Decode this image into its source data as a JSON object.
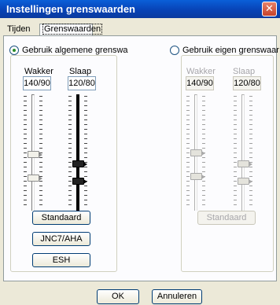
{
  "window": {
    "title": "Instellingen grenswaarden",
    "close_glyph": "✕"
  },
  "tabs": [
    {
      "label": "Tijden"
    },
    {
      "label": "Grenswaarden"
    }
  ],
  "left_panel": {
    "radio_label": "Gebruik algemene grenswa",
    "checked": true,
    "wakker_label": "Wakker",
    "slaap_label": "Slaap",
    "wakker_value": "140/90",
    "slaap_value": "120/80",
    "buttons": [
      "Standaard",
      "JNC7/AHA",
      "ESH"
    ]
  },
  "right_panel": {
    "radio_label": "Gebruik eigen grenswaar",
    "checked": false,
    "wakker_label": "Wakker",
    "slaap_label": "Slaap",
    "wakker_value": "140/90",
    "slaap_value": "120/80",
    "button": "Standaard"
  },
  "footer": {
    "ok_label": "OK",
    "cancel_label": "Annuleren"
  }
}
